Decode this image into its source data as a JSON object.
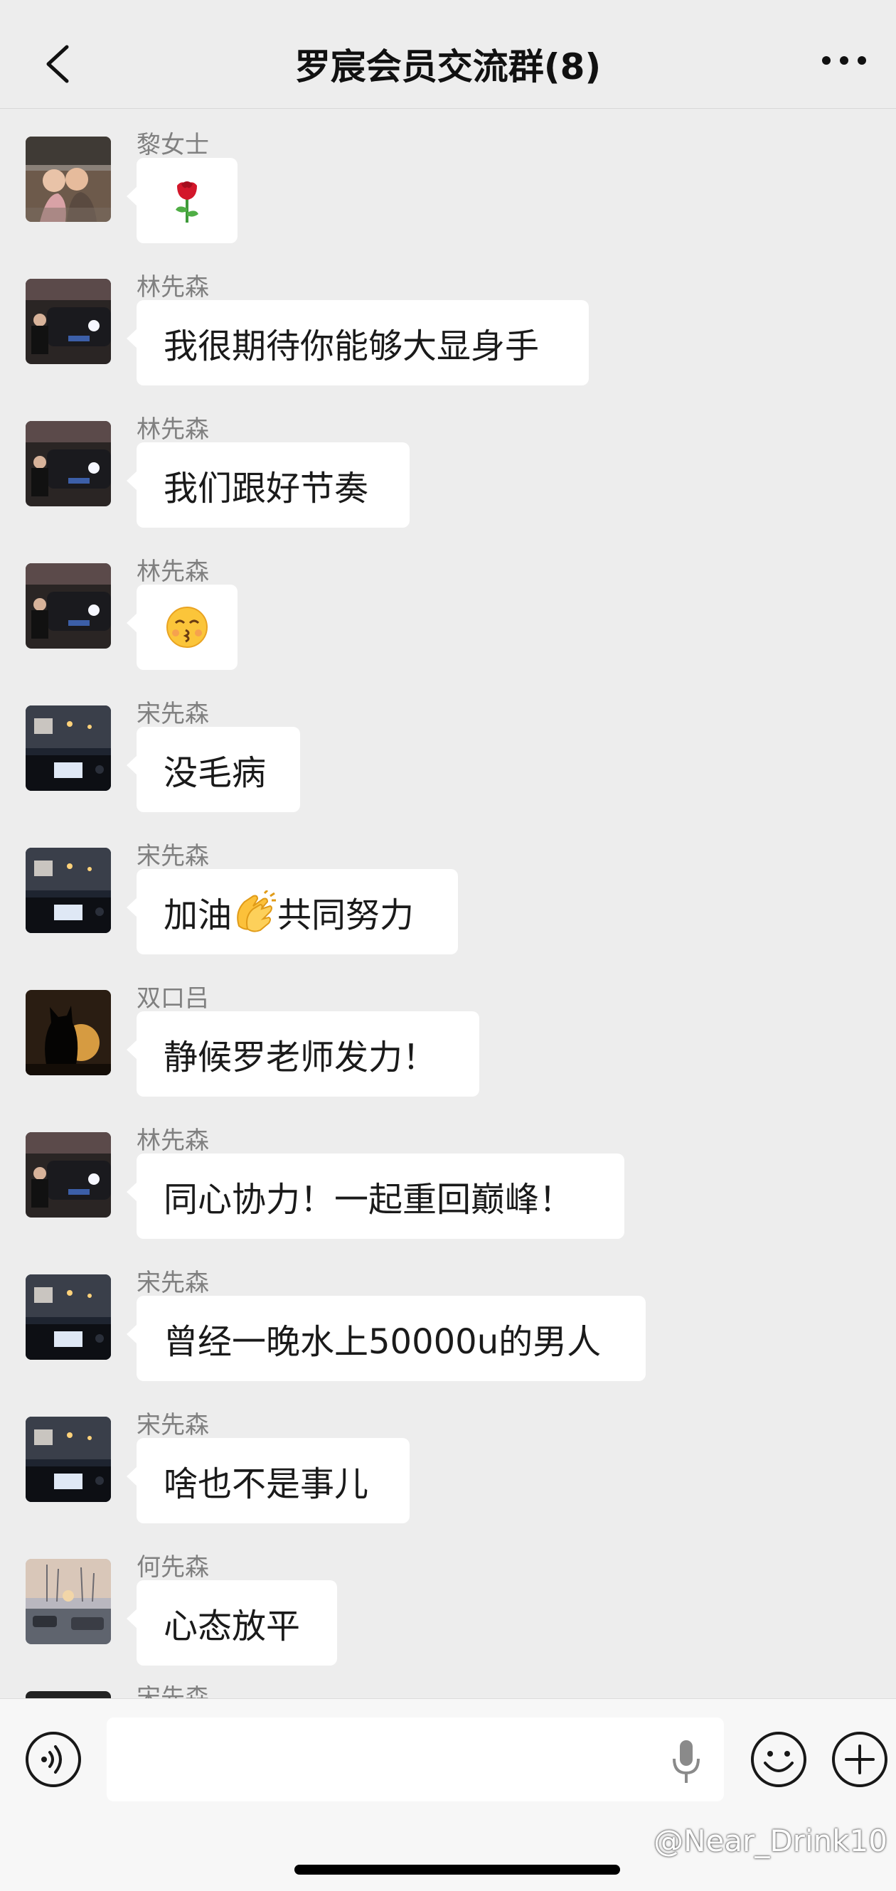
{
  "header": {
    "title": "罗宸会员交流群(8)",
    "back_icon": "chevron-left-icon",
    "more_icon": "ellipsis-icon"
  },
  "messages": [
    {
      "sender": "黎女士",
      "text": "",
      "emoji": "rose"
    },
    {
      "sender": "林先森",
      "text": "我很期待你能够大显身手"
    },
    {
      "sender": "林先森",
      "text": "我们跟好节奏"
    },
    {
      "sender": "林先森",
      "text": "",
      "emoji": "kissing-face"
    },
    {
      "sender": "宋先森",
      "text": "没毛病"
    },
    {
      "sender": "宋先森",
      "text_before": "加油",
      "emoji": "clapping-hands",
      "text_after": "共同努力"
    },
    {
      "sender": "双口吕",
      "text": "静候罗老师发力！"
    },
    {
      "sender": "林先森",
      "text": "同心协力！一起重回巅峰！"
    },
    {
      "sender": "宋先森",
      "text": "曾经一晚水上50000u的男人"
    },
    {
      "sender": "宋先森",
      "text": "啥也不是事儿"
    },
    {
      "sender": "何先森",
      "text": "心态放平"
    }
  ],
  "partial_sender": "宋先森",
  "input": {
    "value": "",
    "voice_icon": "voice-mode-icon",
    "mic_icon": "microphone-icon",
    "emoji_icon": "emoji-icon",
    "plus_icon": "plus-icon"
  },
  "watermark": "@Near_Drink10",
  "colors": {
    "background": "#ededed",
    "bubble": "#ffffff",
    "sender_name": "#808080"
  }
}
